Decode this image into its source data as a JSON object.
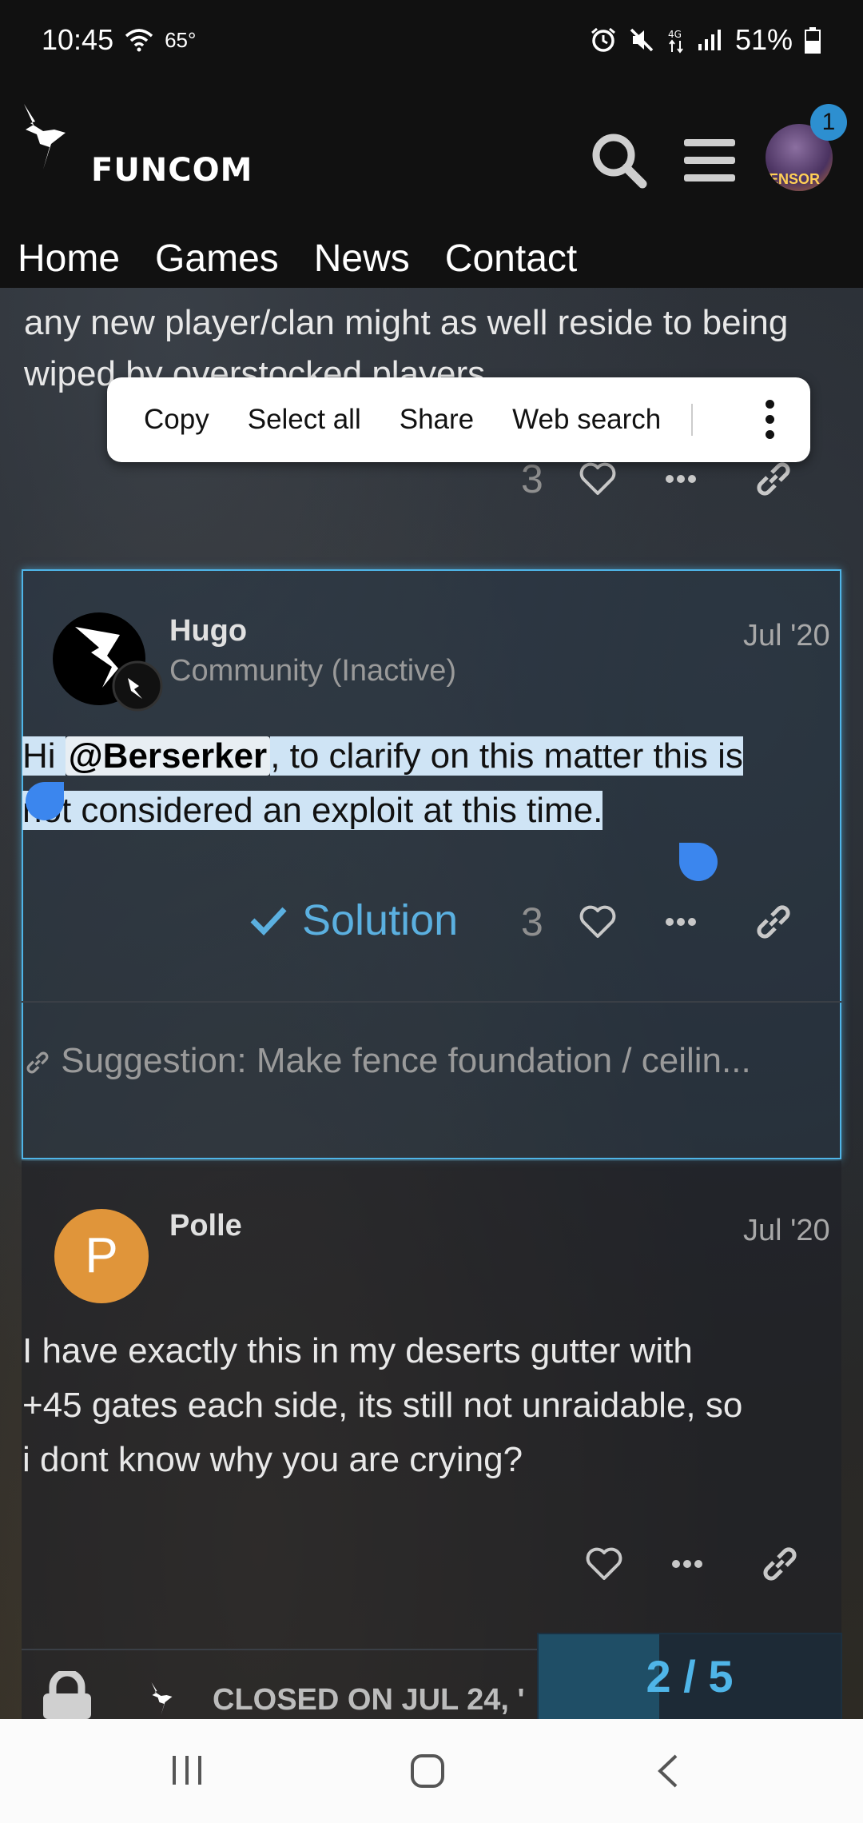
{
  "status_bar": {
    "time": "10:45",
    "temp": "65°",
    "battery": "51%"
  },
  "header": {
    "logo_text": "FUNCOM",
    "notification_count": "1",
    "avatar_text": "ENSOR"
  },
  "nav": {
    "items": [
      "Home",
      "Games",
      "News",
      "Contact"
    ]
  },
  "previous_post": {
    "text": "any new player/clan might as well reside to being wiped by overstocked players",
    "likes": "3"
  },
  "context_menu": {
    "items": [
      "Copy",
      "Select all",
      "Share",
      "Web search"
    ]
  },
  "highlighted_post": {
    "username": "Hugo",
    "user_title": "Community (Inactive)",
    "date": "Jul '20",
    "text_prefix": "Hi ",
    "mention": "@Berserker",
    "text_line1_rest": ", to clarify on this matter this is",
    "text_line2": "not considered an exploit at this time.",
    "solution_label": "Solution",
    "likes": "3",
    "linked_topic": "Suggestion: Make fence foundation / ceilin..."
  },
  "next_post": {
    "username": "Polle",
    "avatar_letter": "P",
    "date": "Jul '20",
    "lines": [
      "I have exactly this in my deserts gutter with",
      "+45 gates each side, its still not unraidable, so",
      "i dont know why you are crying?"
    ]
  },
  "footer": {
    "closed_text": "CLOSED ON JUL 24, '",
    "progress": "2 / 5",
    "progress_fraction": 0.4
  },
  "colors": {
    "accent": "#4fb5e8",
    "selection": "#cfe4f5",
    "avatar_polle": "#e0953a"
  }
}
